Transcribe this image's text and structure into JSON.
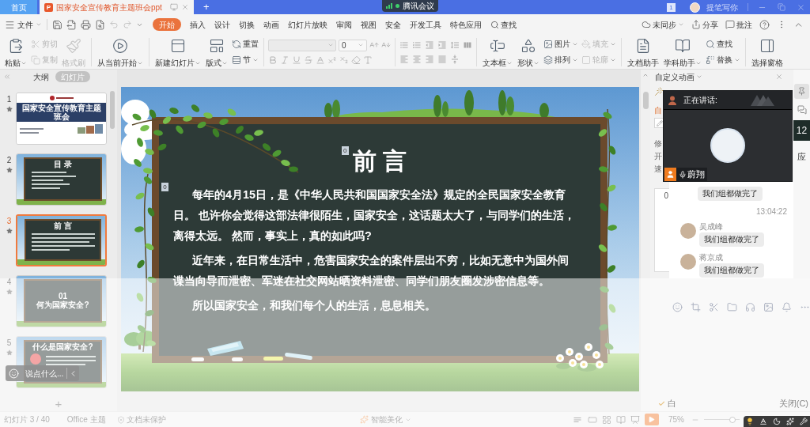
{
  "title_bar": {
    "tabs": [
      {
        "label": "首页",
        "kind": "home",
        "selected": false
      },
      {
        "label": "国家安全宣传教育主题班会ppt",
        "kind": "document",
        "icon_letter": "P",
        "selected": true
      }
    ],
    "new_tab": "+",
    "meeting": "腾讯会议",
    "badge": "1",
    "user_name": "提笔写你"
  },
  "menu_bar": {
    "file": "文件",
    "tabs": [
      {
        "label": "开始",
        "selected": true
      },
      {
        "label": "插入",
        "selected": false
      },
      {
        "label": "设计",
        "selected": false
      },
      {
        "label": "切换",
        "selected": false
      },
      {
        "label": "动画",
        "selected": false
      },
      {
        "label": "幻灯片放映",
        "selected": false
      },
      {
        "label": "审阅",
        "selected": false
      },
      {
        "label": "视图",
        "selected": false
      },
      {
        "label": "安全",
        "selected": false
      },
      {
        "label": "开发工具",
        "selected": false
      },
      {
        "label": "特色应用",
        "selected": false
      }
    ],
    "search": "查找",
    "actions": [
      {
        "label": "未同步",
        "kind": "sync",
        "dropdown": true
      },
      {
        "label": "分享",
        "kind": "share",
        "dropdown": false
      },
      {
        "label": "批注",
        "kind": "comment",
        "dropdown": false
      }
    ]
  },
  "ribbon": {
    "items": [
      {
        "label": "粘贴",
        "disabled": false,
        "dropdown": true
      },
      {
        "label": "剪切",
        "disabled": true,
        "dropdown": false
      },
      {
        "label": "复制",
        "disabled": true,
        "dropdown": false
      },
      {
        "label": "格式刷",
        "disabled": true,
        "dropdown": false
      },
      {
        "label": "从当前开始",
        "disabled": false,
        "dropdown": true
      },
      {
        "label": "新建幻灯片",
        "disabled": false,
        "dropdown": true
      },
      {
        "label": "版式",
        "disabled": false,
        "dropdown": true
      },
      {
        "label": "重置",
        "disabled": false,
        "dropdown": false
      },
      {
        "label": "节",
        "disabled": false,
        "dropdown": true
      },
      {
        "label": "文本框",
        "disabled": false,
        "dropdown": true
      },
      {
        "label": "形状",
        "disabled": false,
        "dropdown": true
      },
      {
        "label": "图片",
        "disabled": false,
        "dropdown": true
      },
      {
        "label": "排列",
        "disabled": false,
        "dropdown": true
      },
      {
        "label": "填充",
        "disabled": true,
        "dropdown": true
      },
      {
        "label": "轮廓",
        "disabled": true,
        "dropdown": true
      },
      {
        "label": "文档助手",
        "disabled": false,
        "dropdown": false
      },
      {
        "label": "学科助手",
        "disabled": false,
        "dropdown": true
      },
      {
        "label": "查找",
        "disabled": false,
        "dropdown": false
      },
      {
        "label": "替换",
        "disabled": false,
        "dropdown": true
      },
      {
        "label": "选择窗格",
        "disabled": false,
        "dropdown": false
      }
    ],
    "font_size": "0"
  },
  "slide_panel": {
    "view_tabs": [
      {
        "label": "大纲",
        "selected": false
      },
      {
        "label": "幻灯片",
        "selected": true
      }
    ],
    "slides": [
      {
        "number": "1",
        "kind": "cover",
        "title": "国家安全宣传教育主题班会",
        "selected": false
      },
      {
        "number": "2",
        "kind": "contents",
        "title": "目 录",
        "selected": false
      },
      {
        "number": "3",
        "kind": "text",
        "title": "前 言",
        "selected": true
      },
      {
        "number": "4",
        "kind": "section",
        "section": "01",
        "title": "何为国家安全?",
        "selected": false
      },
      {
        "number": "5",
        "kind": "text_image",
        "title": "什么是国家安全?",
        "selected": false
      }
    ],
    "add_slide": "+"
  },
  "slide": {
    "title": "前 言",
    "title_marker": "0",
    "paragraph_marker": "0",
    "paragraphs": [
      "每年的4月15日，是《中华人民共和国国家安全法》规定的全民国家安全教育日。 也许你会觉得这部法律很陌生，国家安全，这话题太大了，与同学们的生活，离得太远。 然而，事实上，真的如此吗?",
      "近年来，在日常生活中，危害国家安全的案件层出不穷，比如无意中为国外间谍当向导而泄密、军迷在社交网站晒资料泄密、同学们朋友圈发涉密信息等。",
      "所以国家安全，和我们每个人的生活，息息相关。"
    ]
  },
  "animation_pane": {
    "title": "自定义动画",
    "fragments": [
      {
        "text": "自",
        "kind": "accent"
      },
      {
        "text": "修",
        "kind": "label"
      },
      {
        "text": "开",
        "kind": "label"
      },
      {
        "text": "速",
        "kind": "label"
      }
    ],
    "list_marker": "0",
    "options": [
      {
        "label": "白",
        "checked": true
      }
    ],
    "close_button": "关闭(C)"
  },
  "meeting": {
    "speaking_label": "正在讲话:",
    "speaker": "蔚翔",
    "side_count": "12",
    "side_label": "应",
    "chat": [
      {
        "kind": "bubble",
        "text": "我们组都做完了"
      },
      {
        "kind": "time",
        "text": "13:04:22"
      },
      {
        "kind": "message",
        "sender": "吴成峰",
        "text": "我们组都做完了"
      },
      {
        "kind": "message",
        "sender": "蒋京成",
        "text": "我们组都做完了"
      }
    ],
    "chat_input": {
      "placeholder": "说点什么..."
    }
  },
  "status_bar": {
    "slide_info": "幻灯片 3 / 40",
    "theme": "Office 主题",
    "protection": "文档未保护",
    "beautify": "智能美化",
    "zoom": "75%",
    "zoom_slider": {
      "level": 0.8
    }
  }
}
